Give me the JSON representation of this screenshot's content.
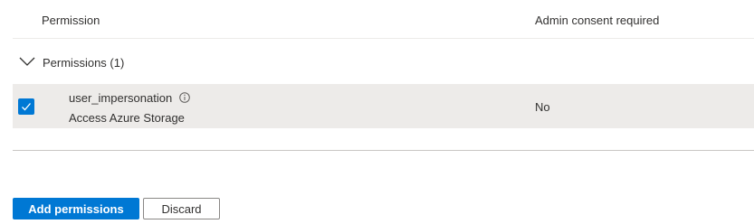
{
  "table": {
    "headers": {
      "permission": "Permission",
      "admin_consent": "Admin consent required"
    },
    "groups": [
      {
        "label": "Permissions (1)",
        "expanded": true,
        "rows": [
          {
            "checked": true,
            "name": "user_impersonation",
            "description": "Access Azure Storage",
            "admin_consent_required": "No",
            "icon": "info-icon"
          }
        ]
      }
    ]
  },
  "actions": {
    "add_label": "Add permissions",
    "discard_label": "Discard"
  },
  "colors": {
    "accent": "#0078d4",
    "selected_row_bg": "#edebe9",
    "text": "#323130"
  }
}
